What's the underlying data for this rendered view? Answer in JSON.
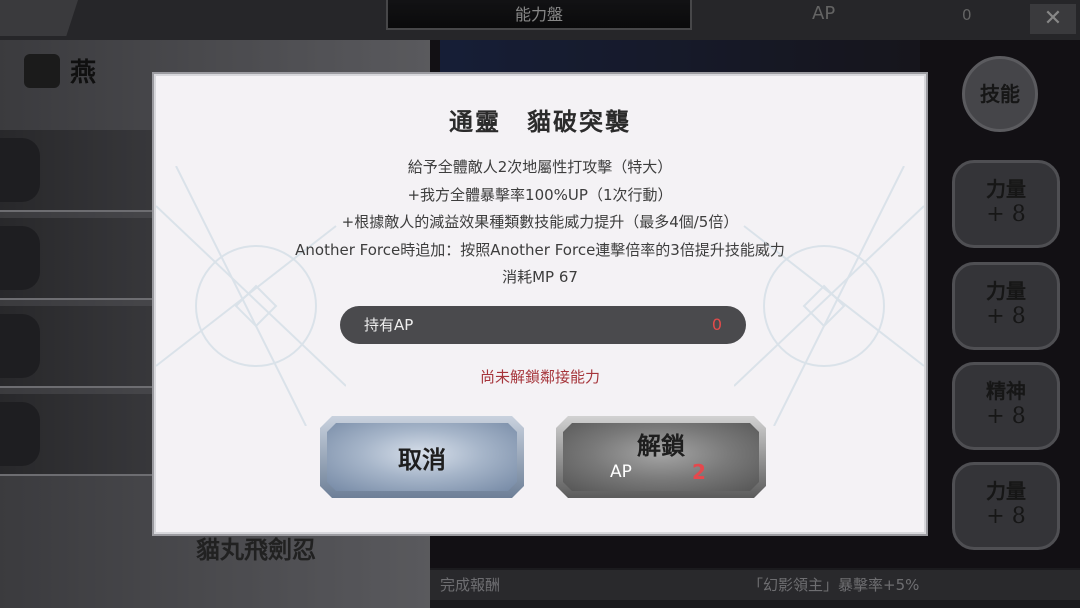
{
  "background": {
    "title_tab": "能力盤",
    "ap_label": "AP",
    "ap_value": "0",
    "character_name": "燕",
    "skill_name": "貓丸飛劍忍",
    "stats": [
      {
        "name": "力量",
        "value": "+ 8"
      },
      {
        "name": "力量",
        "value": "+ 8"
      },
      {
        "name": "精神",
        "value": "+ 8"
      },
      {
        "name": "力量",
        "value": "+ 8"
      }
    ],
    "badge": "技能",
    "footer_label": "完成報酬",
    "footer_value": "「幻影領主」暴擊率+5%"
  },
  "dialog": {
    "title": "通靈　貓破突襲",
    "description": [
      "給予全體敵人2次地屬性打攻擊（特大）",
      "+我方全體暴擊率100%UP（1次行動）",
      "+根據敵人的減益效果種類數技能威力提升（最多4個/5倍）",
      "Another Force時追加：按照Another Force連擊倍率的3倍提升技能威力",
      "消耗MP 67"
    ],
    "held_ap_label": "持有AP",
    "held_ap_value": "0",
    "warning": "尚未解鎖鄰接能力",
    "cancel_label": "取消",
    "unlock_label": "解鎖",
    "unlock_cost_label": "AP",
    "unlock_cost_value": "2"
  },
  "colors": {
    "warning": "#a6353b",
    "ap_value": "#e24b4b",
    "cost_value": "#e5484d"
  }
}
